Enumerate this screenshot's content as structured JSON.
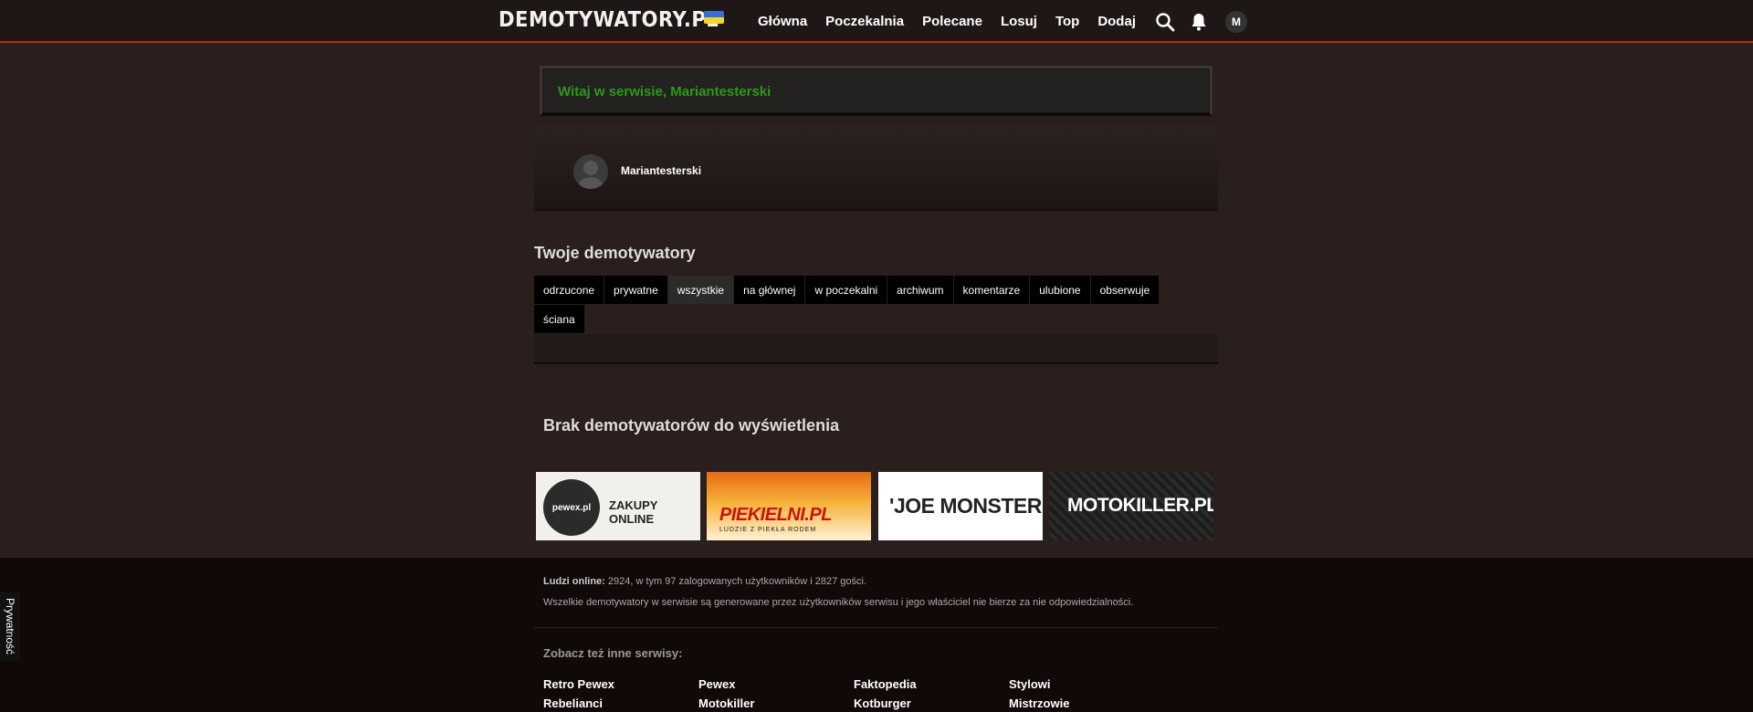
{
  "header": {
    "logo": "DEMOTYWATORY.PL",
    "nav": [
      "Główna",
      "Poczekalnia",
      "Polecane",
      "Losuj",
      "Top",
      "Dodaj"
    ],
    "user_initial": "M",
    "flag_colors": [
      "#3a6fd1",
      "#f1d531"
    ]
  },
  "welcome": {
    "text": "Witaj w serwisie, Mariantesterski"
  },
  "profile": {
    "username": "Mariantesterski"
  },
  "section": {
    "title": "Twoje demotywatory"
  },
  "tabs": [
    {
      "label": "odrzucone"
    },
    {
      "label": "prywatne"
    },
    {
      "label": "wszystkie",
      "active": true
    },
    {
      "label": "na głównej"
    },
    {
      "label": "w poczekalni"
    },
    {
      "label": "archiwum"
    },
    {
      "label": "komentarze"
    },
    {
      "label": "ulubione"
    },
    {
      "label": "obserwuje"
    },
    {
      "label": "ściana"
    }
  ],
  "empty_message": "Brak demotywatorów do wyświetlenia",
  "banners": {
    "pewex": {
      "logo": "pewex.pl",
      "text": "ZAKUPY ONLINE"
    },
    "piekielni": {
      "text": "PIEKIELNI.PL",
      "sub": "LUDZIE Z PIEKŁA RODEM"
    },
    "joemonster": {
      "text": "'JOE MONSTER"
    },
    "motokiller": {
      "text": "MOTOKILLER.PL"
    }
  },
  "footer": {
    "online_label": "Ludzi online:",
    "online_text": "2924, w tym 97 zalogowanych użytkowników i 2827 gości.",
    "disclaimer": "Wszelkie demotywatory w serwisie są generowane przez użytkowników serwisu i jego właściciel nie bierze za nie odpowiedzialności.",
    "see_also": "Zobacz też inne serwisy:",
    "links": [
      "Retro Pewex",
      "Pewex",
      "Faktopedia",
      "Stylowi",
      "Rebelianci",
      "Motokiller",
      "Kotburger",
      "Mistrzowie"
    ]
  },
  "privacy_label": "Prywatność"
}
